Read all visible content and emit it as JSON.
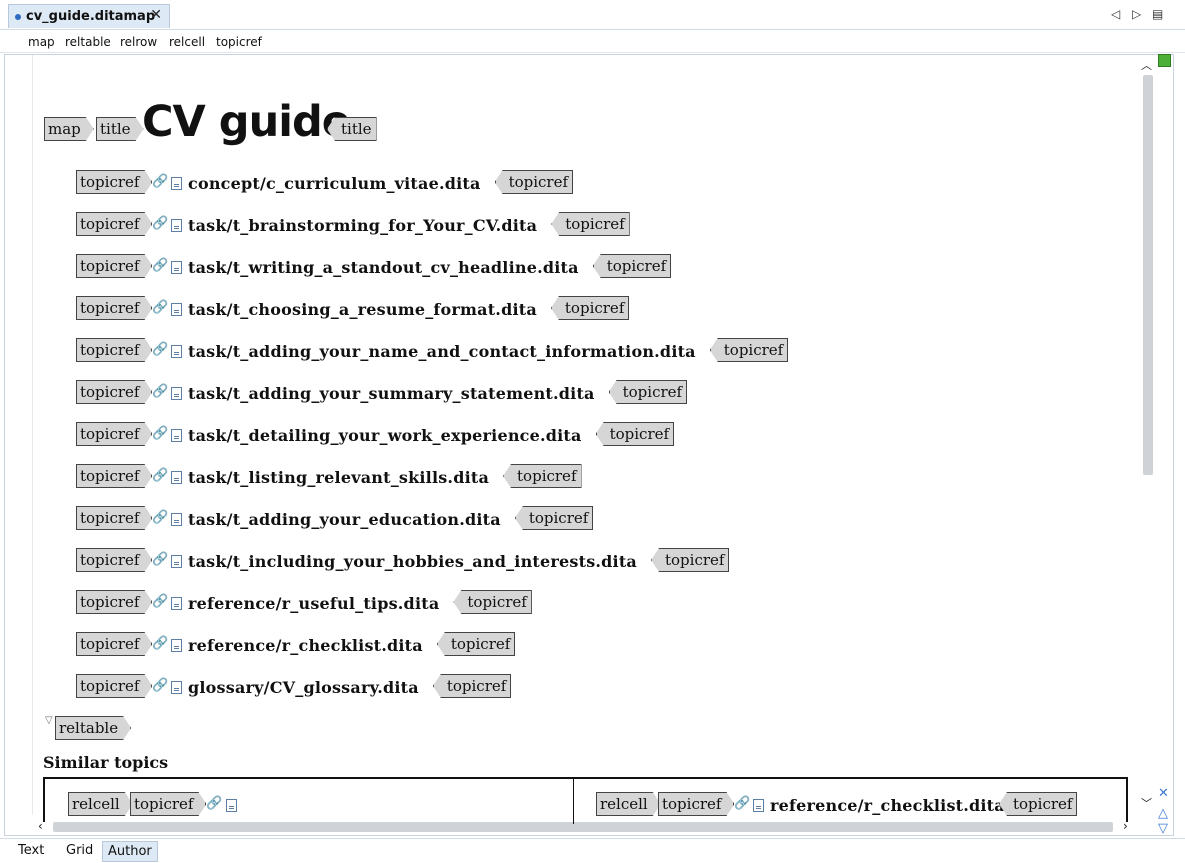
{
  "tab": {
    "title": "cv_guide.ditamap",
    "close": "✕"
  },
  "top_controls": {
    "prev": "◁",
    "next": "▷",
    "menu": "▤"
  },
  "breadcrumb": [
    "map",
    "reltable",
    "relrow",
    "relcell",
    "topicref"
  ],
  "map": {
    "map_tag": "map",
    "title_tag": "title",
    "title": "CV guide",
    "title_close_tag": "title"
  },
  "topicref_label": "topicref",
  "topicrefs": [
    "concept/c_curriculum_vitae.dita",
    "task/t_brainstorming_for_Your_CV.dita",
    "task/t_writing_a_standout_cv_headline.dita",
    "task/t_choosing_a_resume_format.dita",
    "task/t_adding_your_name_and_contact_information.dita",
    "task/t_adding_your_summary_statement.dita",
    "task/t_detailing_your_work_experience.dita",
    "task/t_listing_relevant_skills.dita",
    "task/t_adding_your_education.dita",
    "task/t_including_your_hobbies_and_interests.dita",
    "reference/r_useful_tips.dita",
    "reference/r_checklist.dita",
    "glossary/CV_glossary.dita"
  ],
  "reltable": {
    "tag": "reltable",
    "heading": "Similar topics",
    "cells": [
      {
        "relcell_tag": "relcell",
        "topicref_tag": "topicref",
        "href": ""
      },
      {
        "relcell_tag": "relcell",
        "topicref_tag": "topicref",
        "href": "reference/r_checklist.dita",
        "close_tag": "topicref"
      }
    ]
  },
  "bottom_tabs": [
    {
      "label": "Text",
      "active": false
    },
    {
      "label": "Grid",
      "active": false
    },
    {
      "label": "Author",
      "active": true
    }
  ],
  "colors": {
    "tag_fill": "#d6d6d6",
    "tab_active": "#dde9f4",
    "status_ok": "#4caf37"
  }
}
